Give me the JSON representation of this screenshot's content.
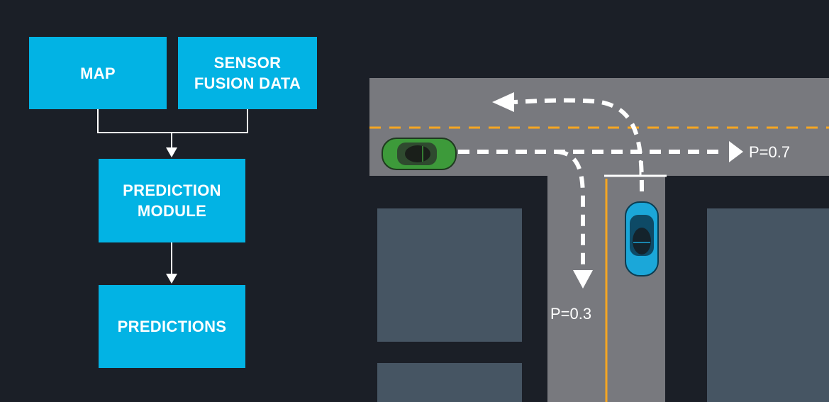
{
  "flowchart": {
    "map_label": "MAP",
    "sensor_label": "SENSOR\nFUSION DATA",
    "prediction_module_label": "PREDICTION\nMODULE",
    "predictions_label": "PREDICTIONS"
  },
  "scene": {
    "straight_probability": "P=0.7",
    "turn_probability": "P=0.3"
  },
  "colors": {
    "background": "#1b1f27",
    "box": "#02b3e4",
    "road": "#78797e",
    "building": "#465563",
    "lane_line": "#f5a623",
    "green_car": "#3d9a3a",
    "blue_car": "#1ba7d9"
  }
}
